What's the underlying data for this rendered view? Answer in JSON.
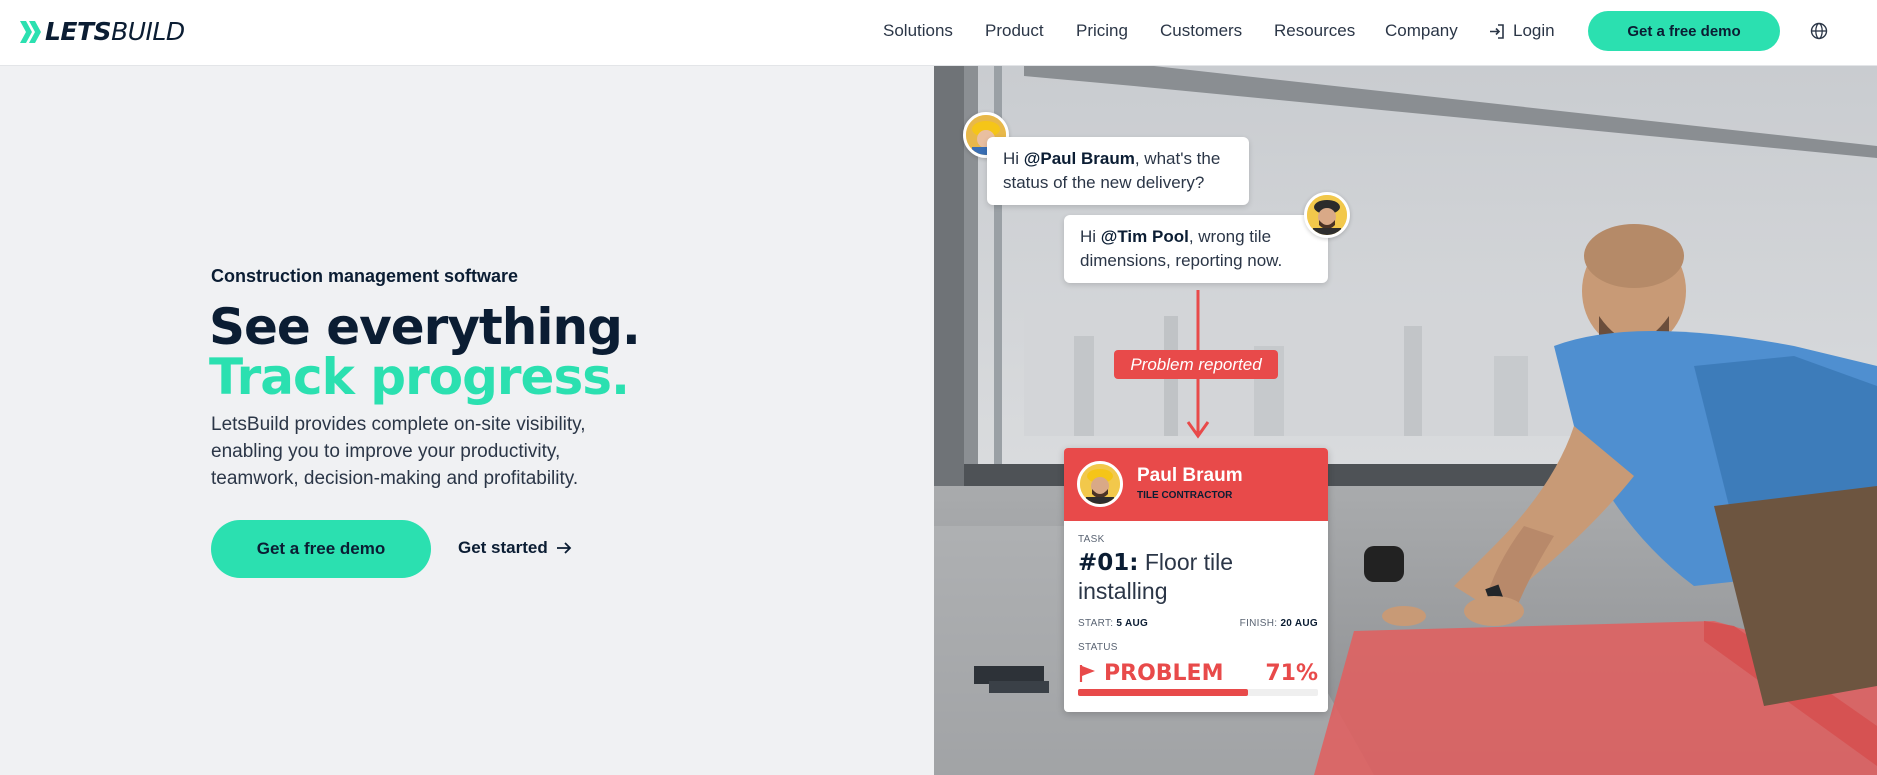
{
  "nav": {
    "logo_bold": "LETS",
    "logo_thin": "BUILD",
    "items": [
      "Solutions",
      "Product",
      "Pricing",
      "Customers",
      "Resources",
      "Company"
    ],
    "login": "Login",
    "demo": "Get a free demo"
  },
  "hero": {
    "eyebrow": "Construction management software",
    "title_line1": "See everything.",
    "title_line2": "Track progress.",
    "description": "LetsBuild provides complete on-site visibility, enabling you to improve your productivity, teamwork, decision-making and profitability.",
    "cta_primary": "Get a free demo",
    "cta_secondary": "Get started"
  },
  "chat": {
    "msg1_prefix": "Hi ",
    "msg1_mention": "@Paul Braum",
    "msg1_suffix": ", what's the status of the new delivery?",
    "msg2_prefix": "Hi ",
    "msg2_mention": "@Tim Pool",
    "msg2_suffix": ", wrong tile dimensions, reporting now.",
    "problem_label": "Problem reported"
  },
  "task_card": {
    "name": "Paul Braum",
    "role": "TILE CONTRACTOR",
    "task_label": "TASK",
    "task_number": "#01:",
    "task_name": "Floor tile installing",
    "start_label": "START:",
    "start_value": "5 AUG",
    "finish_label": "FINISH:",
    "finish_value": "20 AUG",
    "status_label": "STATUS",
    "status_value": "PROBLEM",
    "progress_text": "71%",
    "progress": 0.71
  },
  "colors": {
    "accent": "#2be0b0",
    "navy": "#0b1d33",
    "alert": "#e84a4a"
  }
}
